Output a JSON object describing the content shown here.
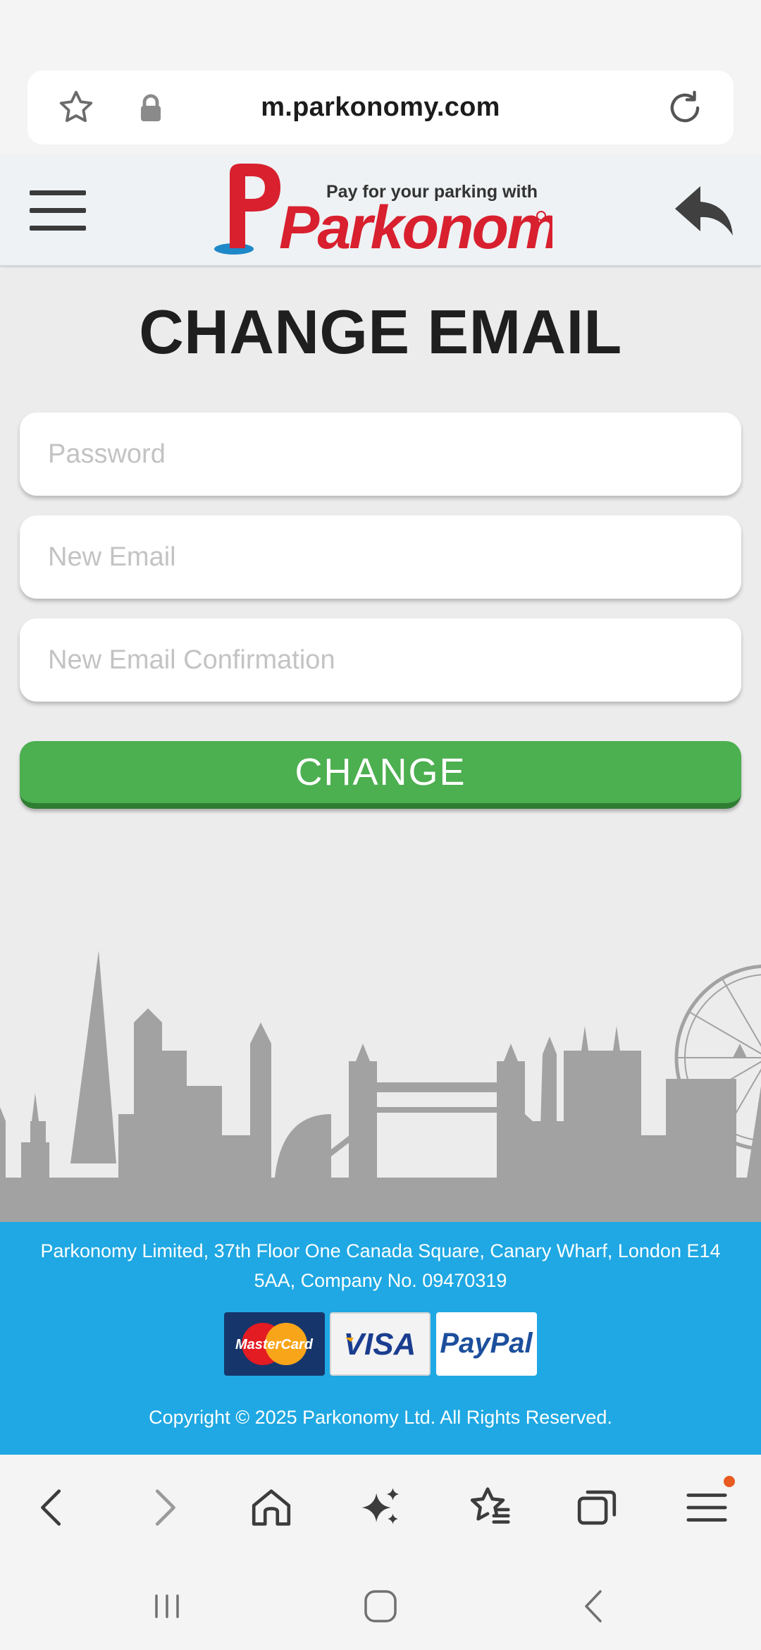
{
  "browser": {
    "url": "m.parkonomy.com"
  },
  "header": {
    "logo_text": "Parkonomy",
    "logo_tagline": "Pay for your parking with"
  },
  "form": {
    "title": "CHANGE EMAIL",
    "password_placeholder": "Password",
    "new_email_placeholder": "New Email",
    "confirm_email_placeholder": "New Email Confirmation",
    "submit_label": "CHANGE"
  },
  "footer": {
    "address": "Parkonomy Limited, 37th Floor One Canada Square, Canary Wharf, London E14 5AA, Company No. 09470319",
    "payment_methods": [
      "MasterCard",
      "VISA",
      "PayPal"
    ],
    "copyright": "Copyright © 2025 Parkonomy Ltd. All Rights Reserved."
  },
  "toolbar": {
    "items": [
      "back-icon",
      "forward-icon",
      "home-icon",
      "ai-sparkle-icon",
      "bookmarks-icon",
      "tabs-icon",
      "menu-icon"
    ]
  },
  "colors": {
    "brand_red": "#d8202f",
    "button_green": "#4caf50",
    "footer_blue": "#1fa8e3",
    "notification_dot": "#e85a1f"
  }
}
